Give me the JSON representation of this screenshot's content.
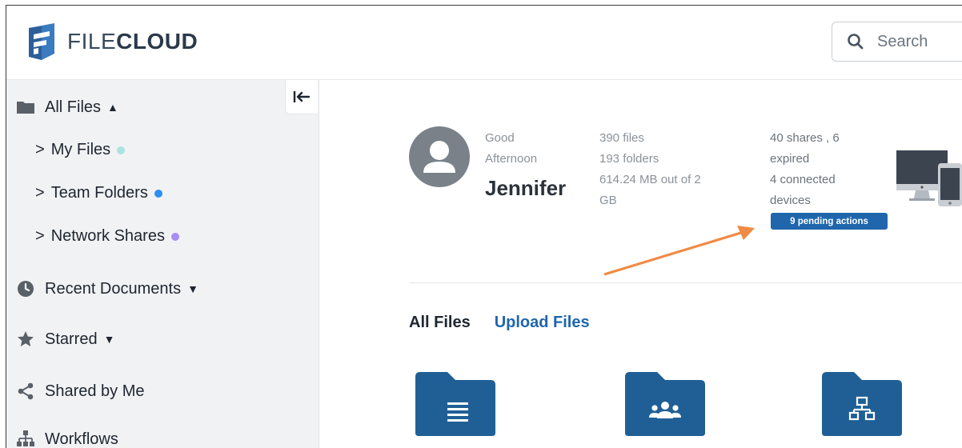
{
  "header": {
    "logo_thin": "FILE",
    "logo_bold": "CLOUD",
    "search_placeholder": "Search"
  },
  "sidebar": {
    "all_files": "All Files",
    "my_files": "My Files",
    "team_folders": "Team Folders",
    "network_shares": "Network Shares",
    "recent_documents": "Recent Documents",
    "starred": "Starred",
    "shared_by_me": "Shared by Me",
    "workflows": "Workflows",
    "sub_marker": ">"
  },
  "colors": {
    "my_files_dot": "#a9e3e3",
    "team_folders_dot": "#2c8ff0",
    "network_shares_dot": "#a98cf3",
    "brand": "#1f66ad",
    "arrow": "#f08a44"
  },
  "profile": {
    "greeting_line1": "Good",
    "greeting_line2": "Afternoon",
    "name": "Jennifer",
    "files": "390 files",
    "folders": "193 folders",
    "storage_line1": "614.24 MB out of 2",
    "storage_line2": "GB",
    "shares_line1": "40 shares , 6",
    "shares_line2": "expired",
    "devices_line1": "4 connected",
    "devices_line2": "devices",
    "pending": "9 pending actions"
  },
  "tabs": {
    "all_files": "All Files",
    "upload_files": "Upload Files"
  },
  "folders": [
    {
      "icon": "document-folder-icon"
    },
    {
      "icon": "team-folder-icon"
    },
    {
      "icon": "network-folder-icon"
    }
  ]
}
